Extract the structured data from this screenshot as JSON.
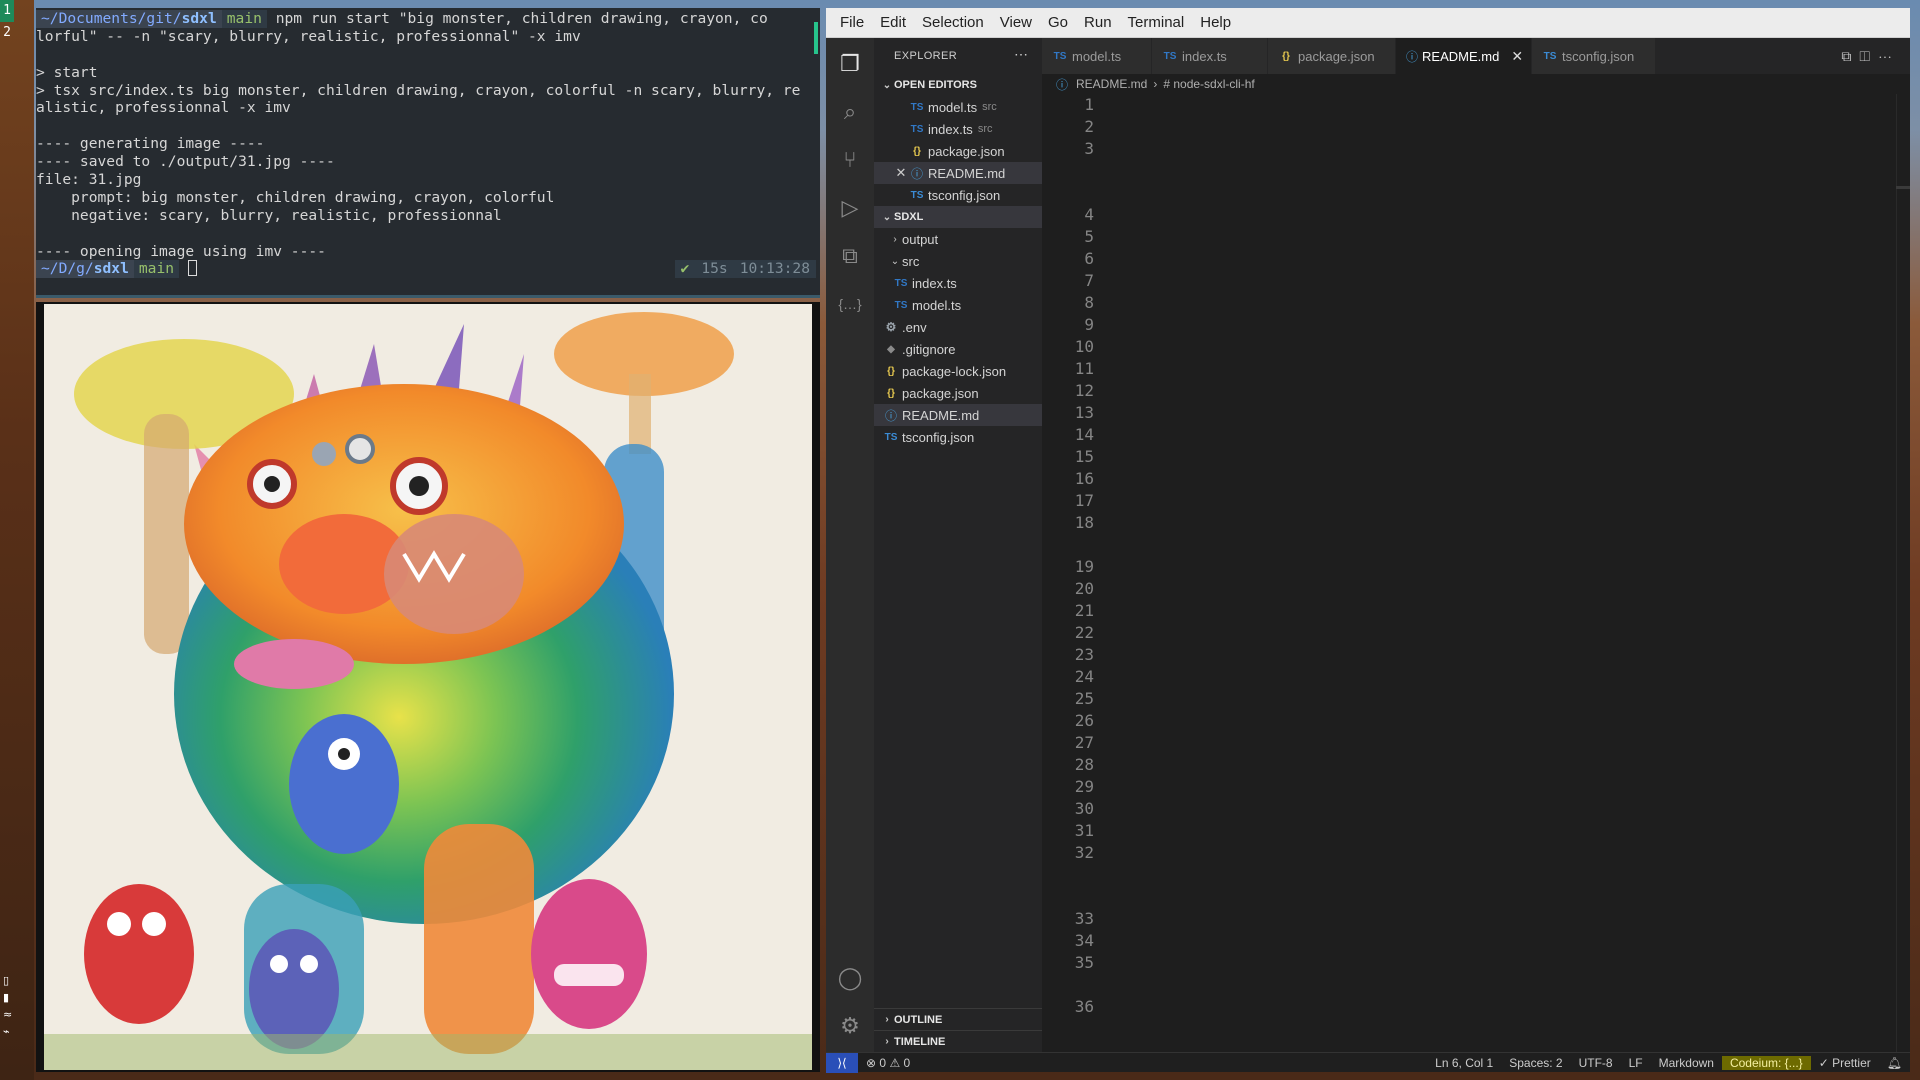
{
  "workspaces": [
    "1",
    "2"
  ],
  "terminal": {
    "prompt": {
      "path_prefix": "~/Documents/git/",
      "path_dir": "sdxl",
      "branch": "main"
    },
    "command_lines": [
      "npm run start \"big monster, children drawing, crayon, co",
      "lorful\" -- -n \"scary, blurry, realistic, professionnal\" -x imv"
    ],
    "output": [
      "",
      "> start",
      "> tsx src/index.ts big monster, children drawing, crayon, colorful -n scary, blurry, re",
      "alistic, professionnal -x imv",
      "",
      "---- generating image ----",
      "---- saved to ./output/31.jpg ----",
      "file: 31.jpg",
      "    prompt: big monster, children drawing, crayon, colorful",
      "    negative: scary, blurry, realistic, professionnal",
      "",
      "---- opening image using imv ----"
    ],
    "prompt2": {
      "path_prefix": "~/D/g/",
      "path_dir": "sdxl",
      "branch": "main"
    },
    "status": {
      "ok": "✔",
      "duration": "15s",
      "time": "10:13:28"
    }
  },
  "vscode": {
    "menu": [
      "File",
      "Edit",
      "Selection",
      "View",
      "Go",
      "Run",
      "Terminal",
      "Help"
    ],
    "activity_icons": [
      "files-icon",
      "search-icon",
      "source-control-icon",
      "run-debug-icon",
      "extensions-icon",
      "json-icon",
      "account-icon",
      "settings-gear-icon"
    ],
    "explorer": {
      "title": "EXPLORER",
      "open_editors_title": "OPEN EDITORS",
      "open_editors": [
        {
          "name": "model.ts",
          "hint": "src",
          "icon": "TS"
        },
        {
          "name": "index.ts",
          "hint": "src",
          "icon": "TS"
        },
        {
          "name": "package.json",
          "hint": "",
          "icon": "{}"
        },
        {
          "name": "README.md",
          "hint": "",
          "icon": "ⓘ"
        },
        {
          "name": "tsconfig.json",
          "hint": "",
          "icon": "TS"
        }
      ],
      "project_title": "SDXL",
      "tree": [
        {
          "name": "output",
          "icon": "›"
        },
        {
          "name": "src",
          "icon": "⌄"
        },
        {
          "name": "index.ts",
          "icon": "TS"
        },
        {
          "name": "model.ts",
          "icon": "TS"
        },
        {
          "name": ".env",
          "icon": "⚙"
        },
        {
          "name": ".gitignore",
          "icon": "◆"
        },
        {
          "name": "package-lock.json",
          "icon": "{}"
        },
        {
          "name": "package.json",
          "icon": "{}"
        },
        {
          "name": "README.md",
          "icon": "ⓘ"
        },
        {
          "name": "tsconfig.json",
          "icon": "TS"
        }
      ],
      "outline": "OUTLINE",
      "timeline": "TIMELINE"
    },
    "tabs": [
      "model.ts",
      "index.ts",
      "package.json",
      "README.md",
      "tsconfig.json"
    ],
    "breadcrumb": {
      "file": "README.md",
      "symbol": "# node-sdxl-cli-hf"
    },
    "line_numbers": [
      "1",
      "2",
      "3",
      "",
      "",
      "4",
      "5",
      "6",
      "7",
      "8",
      "9",
      "10",
      "11",
      "12",
      "13",
      "14",
      "15",
      "16",
      "17",
      "18",
      "",
      "19",
      "20",
      "21",
      "22",
      "23",
      "24",
      "25",
      "26",
      "27",
      "28",
      "29",
      "30",
      "31",
      "32",
      "",
      "",
      "33",
      "34",
      "35",
      "",
      "36"
    ],
    "status": {
      "errors": "0",
      "warnings": "0",
      "cursor": "Ln 6, Col 1",
      "spaces": "Spaces: 2",
      "encoding": "UTF-8",
      "eol": "LF",
      "language": "Markdown",
      "codeium": "Codeium: {...}",
      "prettier": "✓ Prettier"
    },
    "colors": {
      "accent": "#2a4fb8",
      "codeium_bg": "#6d6a00",
      "heading": "#f2c94c"
    }
  }
}
